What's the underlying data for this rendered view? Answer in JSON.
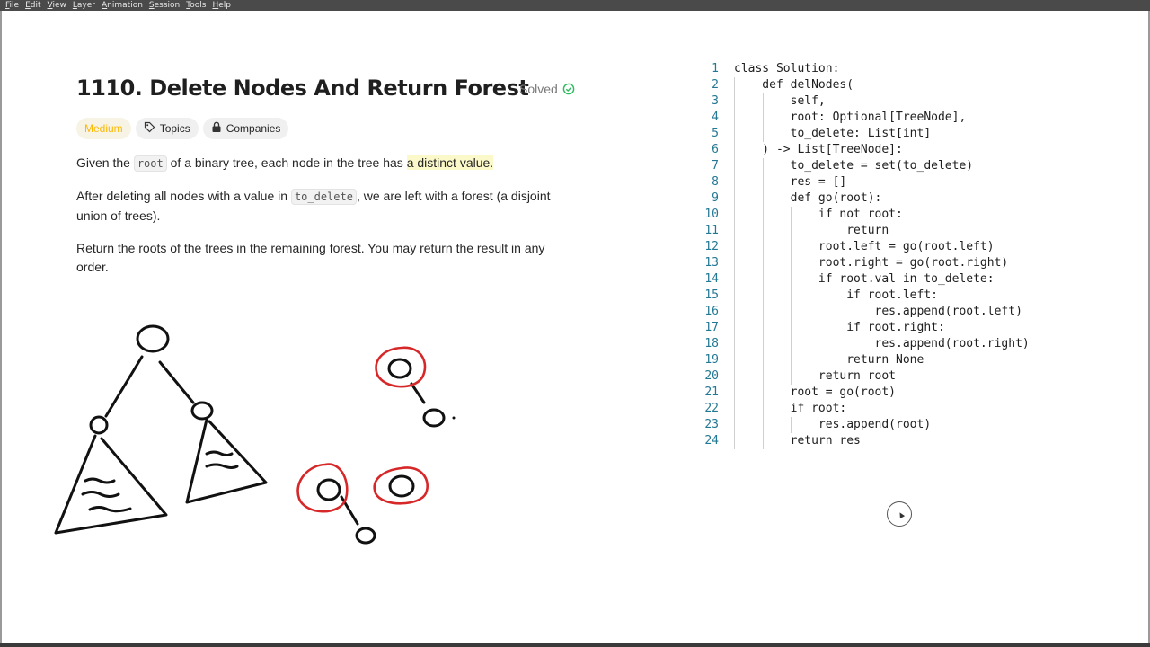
{
  "menu": [
    "File",
    "Edit",
    "View",
    "Layer",
    "Animation",
    "Session",
    "Tools",
    "Help"
  ],
  "problem": {
    "title": "1110. Delete Nodes And Return Forest",
    "status": "Solved",
    "difficulty": "Medium",
    "tags": {
      "topics": "Topics",
      "companies": "Companies"
    },
    "p1": {
      "a": "Given the ",
      "code": "root",
      "b": " of a binary tree, each node in the tree has ",
      "c": "a distinct value."
    },
    "p2": {
      "a": "After deleting all nodes with a value in ",
      "code": "to_delete",
      "b": ", we are left with a forest (a disjoint union of trees)."
    },
    "p3": "Return the roots of the trees in the remaining forest. You may return the result in any order."
  },
  "code": {
    "line_numbers": [
      "1",
      "2",
      "3",
      "4",
      "5",
      "6",
      "7",
      "8",
      "9",
      "10",
      "11",
      "12",
      "13",
      "14",
      "15",
      "16",
      "17",
      "18",
      "19",
      "20",
      "21",
      "22",
      "23",
      "24"
    ],
    "lines": [
      "class Solution:",
      "    def delNodes(",
      "        self,",
      "        root: Optional[TreeNode],",
      "        to_delete: List[int]",
      "    ) -> List[TreeNode]:",
      "        to_delete = set(to_delete)",
      "        res = []",
      "        def go(root):",
      "            if not root:",
      "                return",
      "            root.left = go(root.left)",
      "            root.right = go(root.right)",
      "            if root.val in to_delete:",
      "                if root.left:",
      "                    res.append(root.left)",
      "                if root.right:",
      "                    res.append(root.right)",
      "                return None",
      "            return root",
      "        root = go(root)",
      "        if root:",
      "            res.append(root)",
      "        return res"
    ]
  },
  "colors": {
    "accent_medium": "#ffb700",
    "solved_check": "#2cbb5d",
    "sketch_red": "#d62828",
    "line_number": "#237893"
  }
}
